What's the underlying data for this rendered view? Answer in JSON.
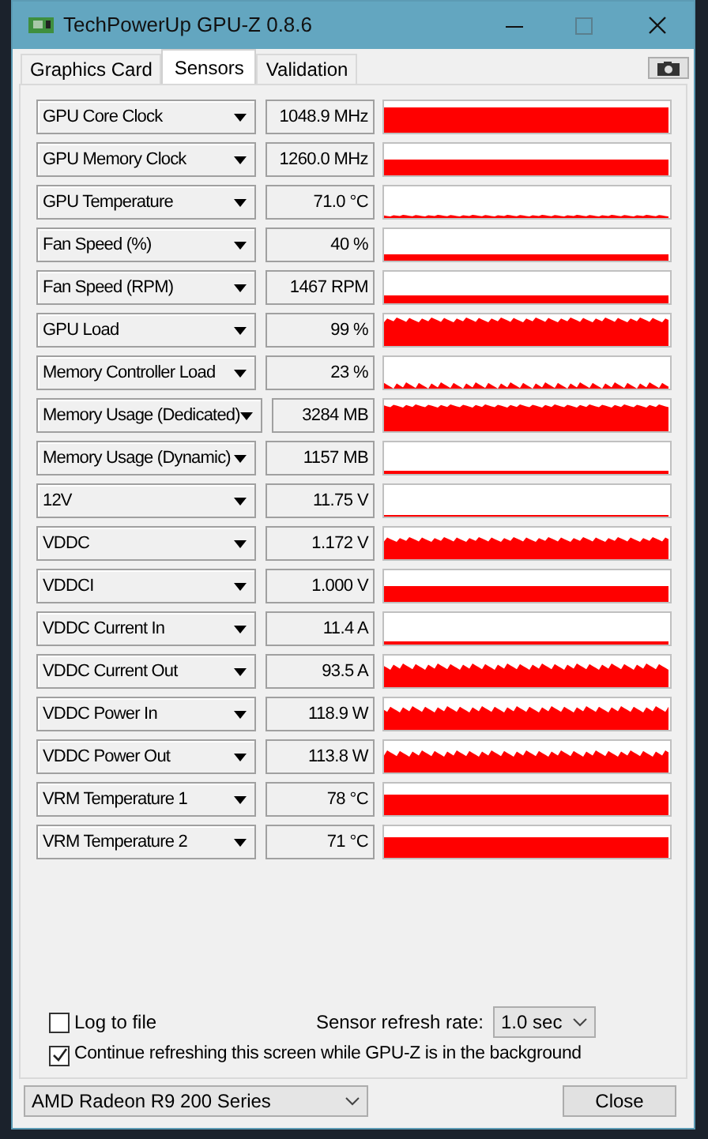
{
  "window": {
    "title": "TechPowerUp GPU-Z 0.8.6"
  },
  "tabs": [
    {
      "label": "Graphics Card",
      "selected": false
    },
    {
      "label": "Sensors",
      "selected": true
    },
    {
      "label": "Validation",
      "selected": false
    }
  ],
  "sensors": [
    {
      "name": "GPU Core Clock",
      "value": "1048.9 MHz"
    },
    {
      "name": "GPU Memory Clock",
      "value": "1260.0 MHz"
    },
    {
      "name": "GPU Temperature",
      "value": "71.0 °C"
    },
    {
      "name": "Fan Speed (%)",
      "value": "40 %"
    },
    {
      "name": "Fan Speed (RPM)",
      "value": "1467 RPM"
    },
    {
      "name": "GPU Load",
      "value": "99 %"
    },
    {
      "name": "Memory Controller Load",
      "value": "23 %"
    },
    {
      "name": "Memory Usage (Dedicated)",
      "value": "3284 MB"
    },
    {
      "name": "Memory Usage (Dynamic)",
      "value": "1157 MB"
    },
    {
      "name": "12V",
      "value": "11.75 V"
    },
    {
      "name": "VDDC",
      "value": "1.172 V"
    },
    {
      "name": "VDDCI",
      "value": "1.000 V"
    },
    {
      "name": "VDDC Current In",
      "value": "11.4 A"
    },
    {
      "name": "VDDC Current Out",
      "value": "93.5 A"
    },
    {
      "name": "VDDC Power In",
      "value": "118.9 W"
    },
    {
      "name": "VDDC Power Out",
      "value": "113.8 W"
    },
    {
      "name": "VRM Temperature 1",
      "value": "78 °C"
    },
    {
      "name": "VRM Temperature 2",
      "value": "71 °C"
    }
  ],
  "log_to_file": {
    "label": "Log to file",
    "checked": false
  },
  "refresh_rate": {
    "label": "Sensor refresh rate:",
    "value": "1.0 sec"
  },
  "continue_refreshing": {
    "label": "Continue refreshing this screen while GPU-Z is in the background",
    "checked": true
  },
  "gpu_select": {
    "value": "AMD Radeon R9 200 Series"
  },
  "close_button": {
    "label": "Close"
  }
}
